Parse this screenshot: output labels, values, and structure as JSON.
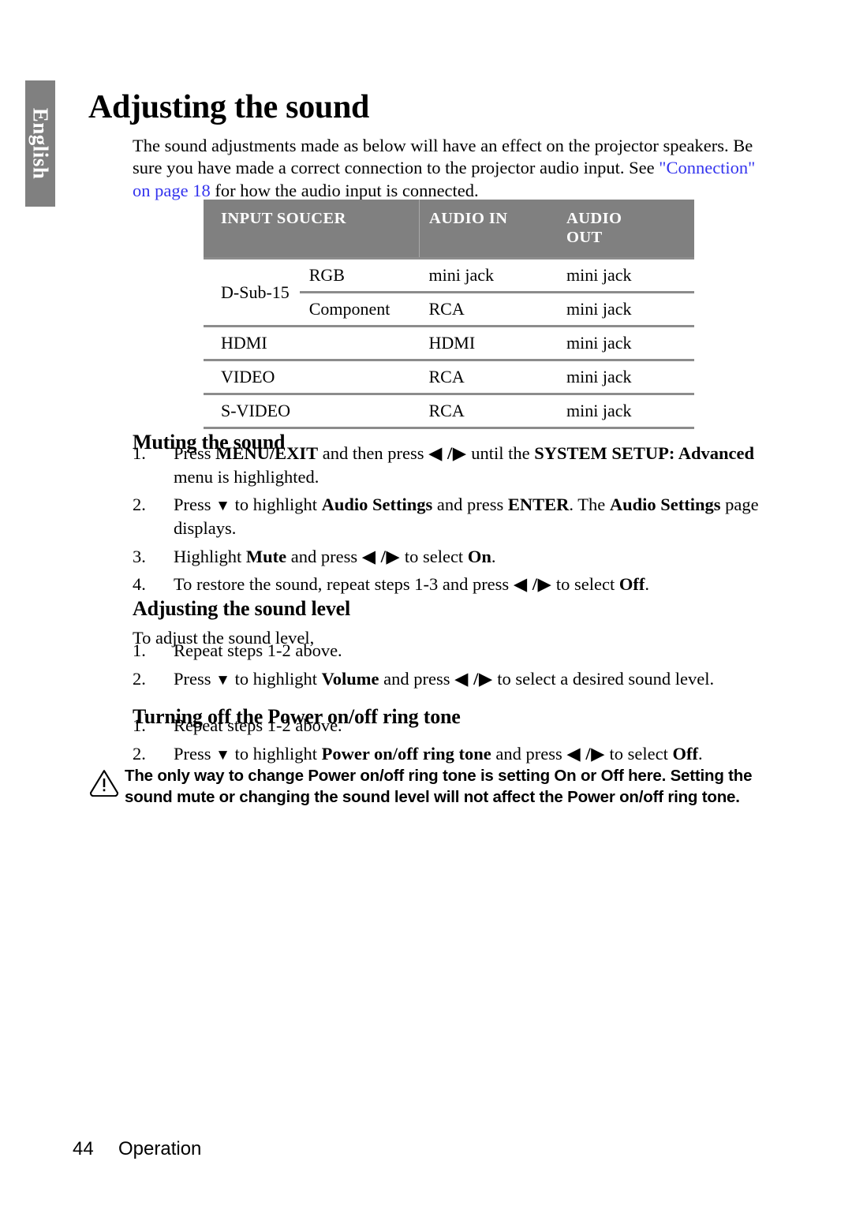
{
  "sidebar": {
    "language_tab": "English"
  },
  "page": {
    "title": "Adjusting the sound",
    "intro_part1": "The sound adjustments made as below will have an effect on the projector speakers. Be sure you have made a correct connection to the projector audio input. See ",
    "intro_link": "\"Connection\" on page 18",
    "intro_part2": " for how the audio input is connected."
  },
  "table": {
    "headers": {
      "source": "INPUT SOUCER",
      "audio_in": "AUDIO IN",
      "audio_out_line1": "AUDIO",
      "audio_out_line2": "OUT"
    },
    "rows": [
      {
        "source": "D-Sub-15",
        "sub": "RGB",
        "audio_in": "mini jack",
        "audio_out": "mini jack"
      },
      {
        "source": "",
        "sub": "Component",
        "audio_in": "RCA",
        "audio_out": "mini jack"
      },
      {
        "source": "HDMI",
        "sub": "",
        "audio_in": "HDMI",
        "audio_out": "mini jack"
      },
      {
        "source": "VIDEO",
        "sub": "",
        "audio_in": "RCA",
        "audio_out": "mini jack"
      },
      {
        "source": "S-VIDEO",
        "sub": "",
        "audio_in": "RCA",
        "audio_out": "mini jack"
      }
    ]
  },
  "sections": {
    "muting": {
      "heading": "Muting the sound",
      "steps": [
        {
          "num": "1.",
          "a": "Press ",
          "b": "MENU/EXIT",
          "c": " and then press ",
          "arrows": "◀ /▶",
          "d": " until the ",
          "e": "SYSTEM SETUP: Advanced",
          "f": " menu is highlighted."
        },
        {
          "num": "2.",
          "a": "Press ",
          "tri": "▼",
          "c": " to highlight ",
          "b": "Audio Settings",
          "d": " and press ",
          "e": "ENTER",
          "f": ". The ",
          "g": "Audio Settings",
          "h": " page displays."
        },
        {
          "num": "3.",
          "a": "Highlight ",
          "b": "Mute",
          "c": " and press ",
          "arrows": "◀ /▶",
          "d": " to select ",
          "e": "On",
          "f": "."
        },
        {
          "num": "4.",
          "a": "To restore the sound, repeat steps 1-3 and press ",
          "arrows": "◀ /▶",
          "d": " to select ",
          "e": "Off",
          "f": "."
        }
      ]
    },
    "level": {
      "heading": "Adjusting the sound level",
      "lead": "To adjust the sound level,",
      "steps": [
        {
          "num": "1.",
          "a": "Repeat steps 1-2 above."
        },
        {
          "num": "2.",
          "a": "Press ",
          "tri": "▼",
          "c": " to highlight ",
          "b": "Volume",
          "d": " and press ",
          "arrows": "◀ /▶",
          "e": " to select a desired sound level."
        }
      ]
    },
    "ring": {
      "heading": "Turning off the Power on/off ring tone",
      "steps": [
        {
          "num": "1.",
          "a": "Repeat steps 1-2 above."
        },
        {
          "num": "2.",
          "a": "Press ",
          "tri": "▼",
          "c": " to highlight ",
          "b": "Power on/off ring tone",
          "d": " and press ",
          "arrows": "◀ /▶",
          "e": " to select ",
          "f": "Off",
          "g": "."
        }
      ]
    }
  },
  "note": {
    "icon": "caution-triangle-icon",
    "text": "The only way to change Power on/off ring tone is setting On or Off here. Setting the sound mute or changing the sound level will not affect the Power on/off ring tone."
  },
  "footer": {
    "page_number": "44",
    "chapter": "Operation"
  },
  "colors": {
    "header_gray": "#808080",
    "rule_gray": "#8c8c8c",
    "link_blue": "#3333ee"
  }
}
